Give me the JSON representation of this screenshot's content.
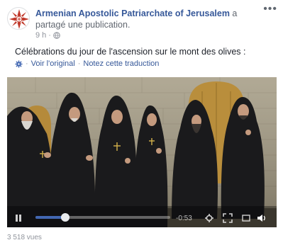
{
  "post": {
    "author": "Armenian Apostolic Patriarchate of Jerusalem",
    "action": " a partagé une publication.",
    "time": "9 h",
    "dot": "·",
    "more_icon": "more-horizontal-icon",
    "text": "Célébrations du jour de l'ascension sur le mont des olives :",
    "see_original": "Voir l'original",
    "separator": "·",
    "rate_translation": "Notez cette traduction"
  },
  "video": {
    "time_remaining": "-0:53",
    "progress": 0.22,
    "icons": [
      "play-icon",
      "settings-icon",
      "expand-icon",
      "volume-icon"
    ]
  },
  "views": "3 518 vues",
  "colors": {
    "link": "#365899",
    "meta": "#90949c",
    "progress": "#4267b2"
  }
}
